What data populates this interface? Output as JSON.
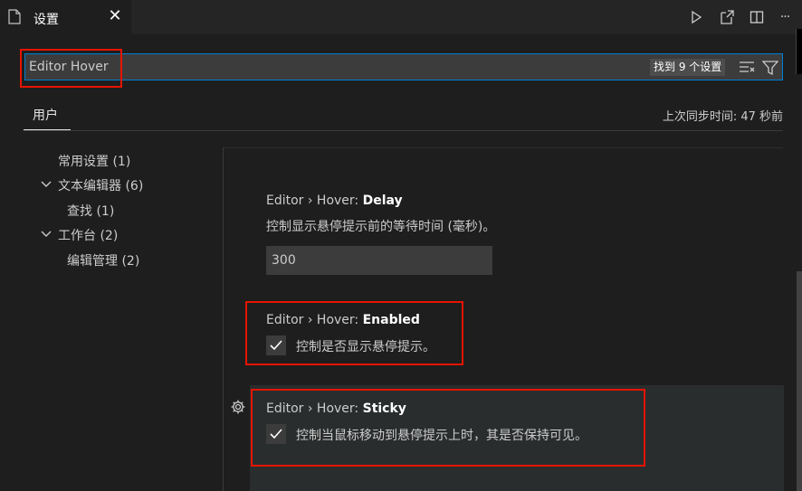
{
  "tab": {
    "title": "设置",
    "close": "✕"
  },
  "toolbar": {
    "more": "···"
  },
  "search": {
    "value": "Editor Hover",
    "count": "找到 9 个设置"
  },
  "header": {
    "user_tab": "用户",
    "sync_status": "上次同步时间: 47 秒前"
  },
  "toc": [
    {
      "label": "常用设置 (1)"
    },
    {
      "label": "文本编辑器 (6)"
    },
    {
      "label": "查找 (1)"
    },
    {
      "label": "工作台 (2)"
    },
    {
      "label": "编辑管理 (2)"
    }
  ],
  "settings": {
    "delay": {
      "prefix": "Editor › Hover: ",
      "name": "Delay",
      "description": "控制显示悬停提示前的等待时间 (毫秒)。",
      "value": "300"
    },
    "enabled": {
      "prefix": "Editor › Hover: ",
      "name": "Enabled",
      "description": "控制是否显示悬停提示。",
      "checked": true
    },
    "sticky": {
      "prefix": "Editor › Hover: ",
      "name": "Sticky",
      "description": "控制当鼠标移动到悬停提示上时，其是否保持可见。",
      "checked": true
    }
  },
  "colors": {
    "highlight": "#e51400",
    "focus": "#007fd4"
  }
}
